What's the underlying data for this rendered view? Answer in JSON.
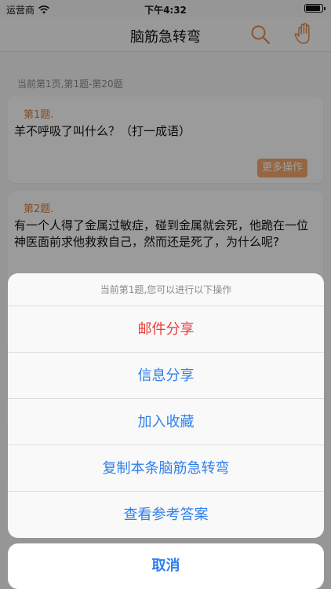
{
  "status_bar": {
    "carrier": "运营商",
    "time": "下午4:32"
  },
  "nav": {
    "title": "脑筋急转弯",
    "icons": [
      "search-icon",
      "hand-icon"
    ]
  },
  "page_info": "当前第1页,第1题-第20题",
  "questions": [
    {
      "number": "第1题.",
      "text": "羊不呼吸了叫什么？（打一成语）",
      "more_label": "更多操作"
    },
    {
      "number": "第2题.",
      "text": "有一个人得了金属过敏症，碰到金属就会死，他跪在一位神医面前求他救救自己，然而还是死了，为什么呢?"
    }
  ],
  "action_sheet": {
    "header": "当前第1题,您可以进行以下操作",
    "actions": [
      {
        "label": "邮件分享",
        "style": "destructive"
      },
      {
        "label": "信息分享",
        "style": "default"
      },
      {
        "label": "加入收藏",
        "style": "default"
      },
      {
        "label": "复制本条脑筋急转弯",
        "style": "default"
      },
      {
        "label": "查看参考答案",
        "style": "default"
      }
    ],
    "cancel_label": "取消"
  },
  "colors": {
    "accent": "#f0a56a",
    "action_blue": "#2f80ed",
    "destructive_red": "#ee3b3b"
  }
}
